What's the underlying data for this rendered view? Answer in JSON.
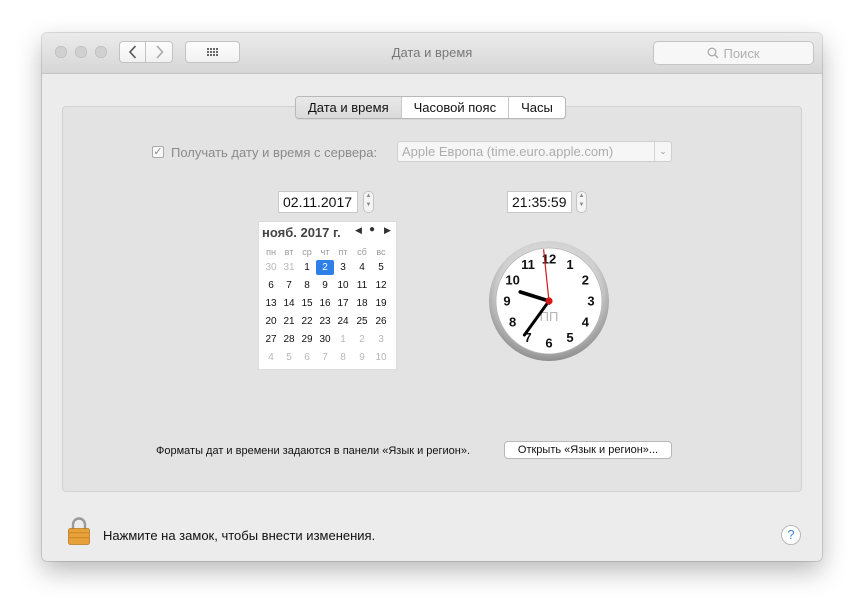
{
  "window": {
    "title": "Дата и время"
  },
  "toolbar": {
    "back_icon": "‹",
    "forward_icon": "›",
    "grid_icon": "grid-icon"
  },
  "search": {
    "placeholder": "Поиск"
  },
  "tabs": [
    {
      "label": "Дата и время",
      "active": true
    },
    {
      "label": "Часовой пояс",
      "active": false
    },
    {
      "label": "Часы",
      "active": false
    }
  ],
  "server_sync": {
    "label": "Получать дату и время с сервера:",
    "checked": true,
    "server": "Apple Европа (time.euro.apple.com)"
  },
  "date_field": "02.11.2017",
  "time_field": "21:35:59",
  "calendar": {
    "month_label": "нояб. 2017 г.",
    "weekdays": [
      "пн",
      "вт",
      "ср",
      "чт",
      "пт",
      "сб",
      "вс"
    ],
    "weeks": [
      [
        "30",
        "31",
        "1",
        "2",
        "3",
        "4",
        "5"
      ],
      [
        "6",
        "7",
        "8",
        "9",
        "10",
        "11",
        "12"
      ],
      [
        "13",
        "14",
        "15",
        "16",
        "17",
        "18",
        "19"
      ],
      [
        "20",
        "21",
        "22",
        "23",
        "24",
        "25",
        "26"
      ],
      [
        "27",
        "28",
        "29",
        "30",
        "1",
        "2",
        "3"
      ],
      [
        "4",
        "5",
        "6",
        "7",
        "8",
        "9",
        "10"
      ]
    ],
    "selected_day": "2"
  },
  "clock": {
    "numbers": [
      "12",
      "1",
      "2",
      "3",
      "4",
      "5",
      "6",
      "7",
      "8",
      "9",
      "10",
      "11"
    ],
    "ampm_label": "ПП",
    "hour": 21,
    "minute": 35,
    "second": 59
  },
  "formats": {
    "text": "Форматы дат и времени задаются в панели «Язык и регион».",
    "button_label": "Открыть «Язык и регион»..."
  },
  "footer": {
    "lock_text": "Нажмите на замок, чтобы внести изменения.",
    "help_label": "?"
  }
}
